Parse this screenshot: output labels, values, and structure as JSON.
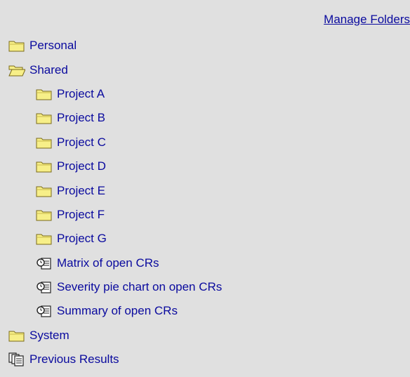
{
  "header": {
    "manage_label": "Manage Folders"
  },
  "tree": {
    "personal": {
      "label": "Personal"
    },
    "shared": {
      "label": "Shared",
      "folders": [
        "Project A",
        "Project B",
        "Project C",
        "Project D",
        "Project E",
        "Project F",
        "Project G"
      ],
      "queries": [
        "Matrix of open CRs",
        "Severity pie chart on open CRs",
        "Summary of open CRs"
      ]
    },
    "system": {
      "label": "System"
    },
    "previous_results": {
      "label": "Previous Results"
    }
  },
  "icons": {
    "closed_folder": "folder-icon",
    "open_folder": "folder-open-icon",
    "query": "query-icon",
    "results": "results-icon"
  },
  "colors": {
    "link": "#0a0a9e",
    "background": "#e0e0e0",
    "folder": "#f7ef88"
  }
}
